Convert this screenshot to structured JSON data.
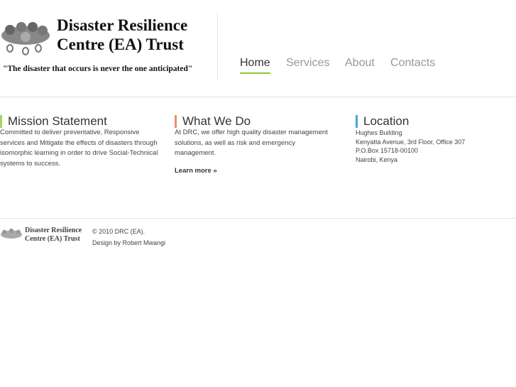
{
  "header": {
    "logo_line1": "Disaster Resilience",
    "logo_line2": "Centre (EA) Trust",
    "tagline": "\"The disaster that occurs is never the one anticipated\""
  },
  "nav": [
    {
      "label": "Home"
    },
    {
      "label": "Services"
    },
    {
      "label": "About"
    },
    {
      "label": "Contacts"
    }
  ],
  "columns": {
    "mission": {
      "title": "Mission Statement",
      "text": "Committed to deliver preventative, Responsive services and Mitigate the effects of disasters through isomorphic learning in order to drive Social-Technical systems to success.",
      "accent": "#a5d26b"
    },
    "whatwedo": {
      "title": "What We Do",
      "text": "At DRC, we offer high quality disaster management solutions, as well as risk and emergency management.",
      "link": "Learn more »",
      "accent": "#f08a6c"
    },
    "location": {
      "title": "Location",
      "lines": [
        "Hughes Building",
        "Kenyatta Avenue, 3rd Floor, Office 307",
        "P.O.Box 15718-00100",
        "Nairobi, Kenya"
      ],
      "accent": "#4aa3d8"
    }
  },
  "footer": {
    "logo_line1": "Disaster Resilience",
    "logo_line2": "Centre (EA) Trust",
    "copyright": "© 2010 DRC (EA).",
    "credit": "Design by Robert Mwangi"
  }
}
